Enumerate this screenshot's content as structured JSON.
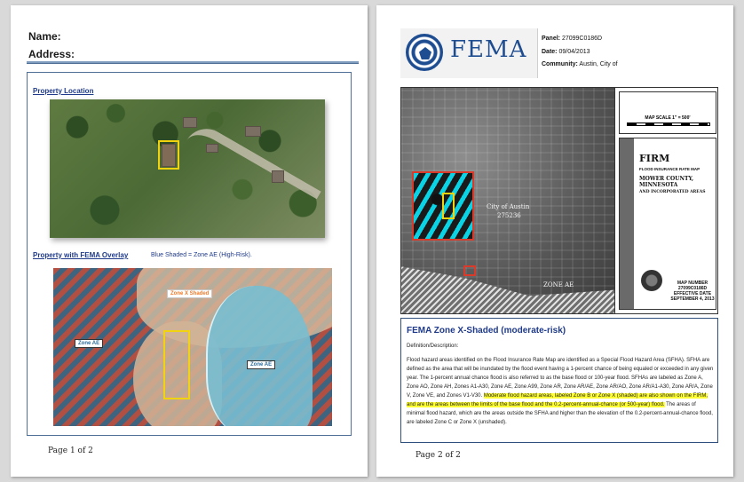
{
  "page1": {
    "name_label": "Name:",
    "address_label": "Address:",
    "property_location_title": "Property Location",
    "fema_overlay_title": "Property with FEMA Overlay",
    "fema_overlay_note": "Blue Shaded = Zone AE (High-Risk).",
    "map_labels": {
      "zone_x_shaded": "Zone X Shaded",
      "zone_ae_left": "Zone AE",
      "zone_ae_right": "Zone AE"
    },
    "footer": "Page 1 of 2"
  },
  "page2": {
    "header": {
      "logo_text": "FEMA",
      "panel_label": "Panel:",
      "panel_value": "27099C0186D",
      "date_label": "Date:",
      "date_value": "09/04/2013",
      "community_label": "Community:",
      "community_value": "Austin, City of"
    },
    "firm_map": {
      "map_label": "FIRM",
      "map_subtitle": "FLOOD INSURANCE RATE MAP",
      "county": "MOWER COUNTY, MINNESOTA",
      "county_sub": "AND INCORPORATED AREAS",
      "city_label": "City of Austin",
      "city_number": "275236",
      "zone_label": "ZONE AE",
      "map_number": "MAP NUMBER 27099C0186D",
      "effective_date": "EFFECTIVE DATE SEPTEMBER 4, 2013",
      "scale_title": "MAP SCALE 1\" = 500'"
    },
    "description": {
      "title": "FEMA Zone X-Shaded (moderate-risk)",
      "label": "Definition/Description:",
      "text_plain": "Flood hazard areas identified on the Flood Insurance Rate Map are identified as a Special Flood Hazard Area (SFHA). SFHA are defined as the area that will be inundated by the flood event having a 1-percent chance of being equaled or exceeded in any given year. The 1-percent annual chance flood is also referred to as the base flood or 100-year flood. SFHAs are labeled as Zone A, Zone AO, Zone AH, Zones A1-A30, Zone AE, Zone A99, Zone AR, Zone AR/AE, Zone AR/AO, Zone AR/A1-A30, Zone AR/A, Zone V, Zone VE, and Zones V1-V30. ",
      "text_highlight": "Moderate flood hazard areas, labeled Zone B or Zone X (shaded) are also shown on the FIRM, and are the areas between the limits of the base flood and the 0.2-percent-annual-chance (or 500-year) flood.",
      "text_tail": " The areas of minimal flood hazard, which are the areas outside the SFHA and higher than the elevation of the 0.2-percent-annual-chance flood, are labeled Zone C or Zone X (unshaded)."
    },
    "footer": "Page 2 of 2"
  },
  "colors": {
    "accent_blue": "#1f3a8a",
    "fema_blue": "#1f4d91",
    "highlight": "#ffff33",
    "zone_rect": "#f2d30f"
  }
}
